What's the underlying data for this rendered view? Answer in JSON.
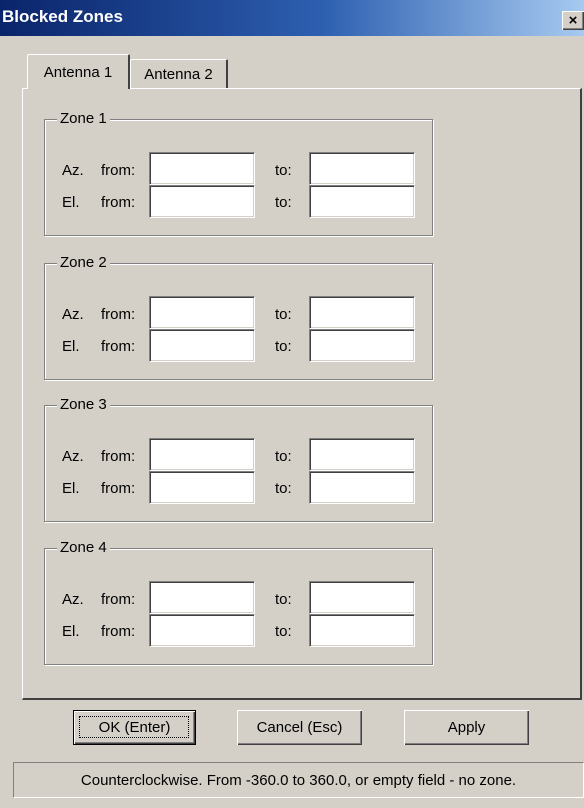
{
  "window": {
    "title": "Blocked Zones",
    "close_glyph": "×",
    "close_icon": "close-icon"
  },
  "tabs": [
    {
      "label": "Antenna 1",
      "selected": true
    },
    {
      "label": "Antenna 2",
      "selected": false
    }
  ],
  "row_labels": {
    "az": "Az.",
    "el": "El.",
    "from": "from:",
    "to": "to:"
  },
  "zones": [
    {
      "label": "Zone 1",
      "az_from": "",
      "az_to": "",
      "el_from": "",
      "el_to": ""
    },
    {
      "label": "Zone 2",
      "az_from": "",
      "az_to": "",
      "el_from": "",
      "el_to": ""
    },
    {
      "label": "Zone 3",
      "az_from": "",
      "az_to": "",
      "el_from": "",
      "el_to": ""
    },
    {
      "label": "Zone 4",
      "az_from": "",
      "az_to": "",
      "el_from": "",
      "el_to": ""
    }
  ],
  "buttons": {
    "ok": "OK (Enter)",
    "cancel": "Cancel (Esc)",
    "apply": "Apply"
  },
  "status": "Counterclockwise. From -360.0 to 360.0, or empty field - no zone.",
  "colors": {
    "face": "#d4d0c8",
    "title_start": "#0a246a",
    "title_end": "#a6caf0"
  }
}
